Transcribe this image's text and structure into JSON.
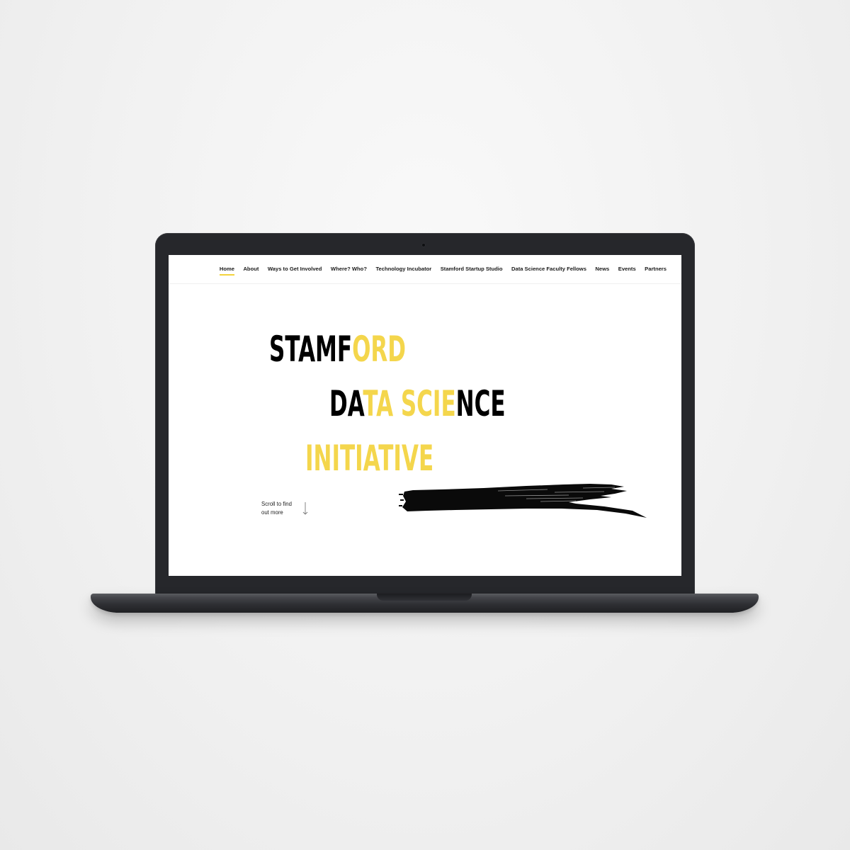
{
  "nav": {
    "items": [
      {
        "label": "Home",
        "active": true
      },
      {
        "label": "About"
      },
      {
        "label": "Ways to Get Involved"
      },
      {
        "label": "Where? Who?"
      },
      {
        "label": "Technology Incubator"
      },
      {
        "label": "Stamford Startup Studio"
      },
      {
        "label": "Data Science Faculty Fellows"
      },
      {
        "label": "News"
      },
      {
        "label": "Events"
      },
      {
        "label": "Partners"
      }
    ],
    "active_underline_color": "#f3d33d"
  },
  "hero": {
    "line1": {
      "black": "STAMF",
      "yellow": "ORD"
    },
    "line2": {
      "black": "DA",
      "yellow": "TA SCIE",
      "black_end": "NCE"
    },
    "line3": {
      "yellow": "INITIATIVE"
    },
    "accent_color": "#f4d64c",
    "text_color": "#000000"
  },
  "scroll": {
    "line1": "Scroll to find",
    "line2": "out more"
  },
  "icons": {
    "scroll_arrow": "arrow-down-icon",
    "brush_stroke": "brush-stroke"
  }
}
